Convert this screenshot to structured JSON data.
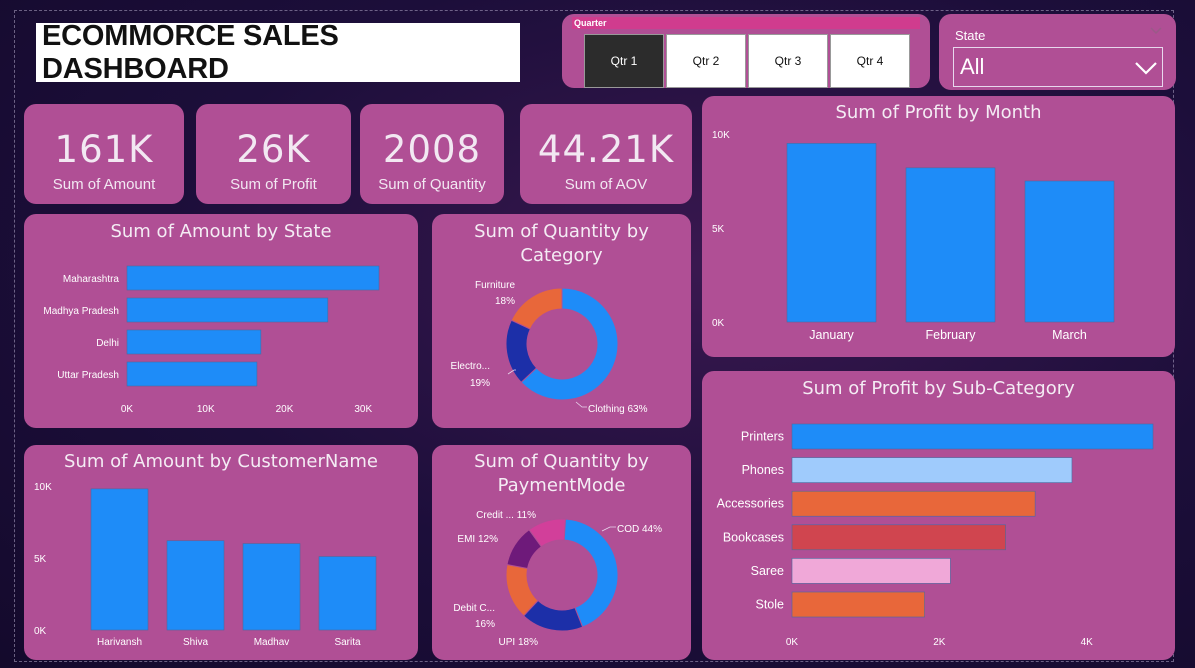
{
  "dashboard": {
    "title": "ECOMMORCE SALES DASHBOARD"
  },
  "quarter_slicer": {
    "title": "Quarter",
    "options": [
      "Qtr 1",
      "Qtr 2",
      "Qtr 3",
      "Qtr 4"
    ],
    "selected": "Qtr 1"
  },
  "state_slicer": {
    "label": "State",
    "value": "All"
  },
  "kpis": [
    {
      "value": "161K",
      "label": "Sum of Amount"
    },
    {
      "value": "26K",
      "label": "Sum of Profit"
    },
    {
      "value": "2008",
      "label": "Sum of Quantity"
    },
    {
      "value": "44.21K",
      "label": "Sum of AOV"
    }
  ],
  "colors": {
    "accent": "#1e8cf8",
    "card": "#b04f95",
    "donut_category": [
      "#1e8cf8",
      "#1c2fa8",
      "#e8673a"
    ],
    "donut_payment": [
      "#1e8cf8",
      "#1c2fa8",
      "#e8673a",
      "#6e1a7a",
      "#d23f9a"
    ],
    "subcategory": [
      "#1e8cf8",
      "#9fcbfc",
      "#e8673a",
      "#d0454f",
      "#f0a8d8",
      "#e8673a"
    ]
  },
  "chart_data": [
    {
      "type": "bar",
      "orientation": "horizontal",
      "title": "Sum of Amount by State",
      "categories": [
        "Maharashtra",
        "Madhya Pradesh",
        "Delhi",
        "Uttar Pradesh"
      ],
      "values": [
        32000,
        25500,
        17000,
        16500
      ],
      "xlim": [
        0,
        32000
      ],
      "x_ticks": [
        "0K",
        "10K",
        "20K",
        "30K"
      ],
      "x_tick_values": [
        0,
        10000,
        20000,
        30000
      ]
    },
    {
      "type": "pie",
      "variant": "donut",
      "title": "Sum of Quantity by Category",
      "slices": [
        {
          "label": "Clothing",
          "pct": 63
        },
        {
          "label": "Electro...",
          "pct": 19
        },
        {
          "label": "Furniture",
          "pct": 18
        }
      ],
      "slice_labels": [
        "Clothing 63%",
        "Electro...",
        "19%",
        "Furniture",
        "18%"
      ]
    },
    {
      "type": "bar",
      "title": "Sum of Profit by Month",
      "categories": [
        "January",
        "February",
        "March"
      ],
      "values": [
        9500,
        8200,
        7500
      ],
      "ylim": [
        0,
        10000
      ],
      "y_ticks": [
        "0K",
        "5K",
        "10K"
      ],
      "y_tick_values": [
        0,
        5000,
        10000
      ]
    },
    {
      "type": "bar",
      "title": "Sum of Amount by CustomerName",
      "categories": [
        "Harivansh",
        "Shiva",
        "Madhav",
        "Sarita"
      ],
      "values": [
        9800,
        6200,
        6000,
        5100
      ],
      "ylim": [
        0,
        10000
      ],
      "y_ticks": [
        "0K",
        "5K",
        "10K"
      ],
      "y_tick_values": [
        0,
        5000,
        10000
      ]
    },
    {
      "type": "pie",
      "variant": "donut",
      "title": "Sum of Quantity by PaymentMode",
      "slices": [
        {
          "label": "COD",
          "pct": 44
        },
        {
          "label": "UPI",
          "pct": 18
        },
        {
          "label": "Debit C...",
          "pct": 16
        },
        {
          "label": "EMI",
          "pct": 12
        },
        {
          "label": "Credit ...",
          "pct": 11
        }
      ],
      "slice_labels": [
        "COD 44%",
        "UPI 18%",
        "Debit C...",
        "16%",
        "EMI 12%",
        "Credit ... 11%"
      ]
    },
    {
      "type": "bar",
      "orientation": "horizontal",
      "title": "Sum of Profit by Sub-Category",
      "categories": [
        "Printers",
        "Phones",
        "Accessories",
        "Bookcases",
        "Saree",
        "Stole"
      ],
      "values": [
        4900,
        3800,
        3300,
        2900,
        2150,
        1800
      ],
      "xlim": [
        0,
        4900
      ],
      "x_ticks": [
        "0K",
        "2K",
        "4K"
      ],
      "x_tick_values": [
        0,
        2000,
        4000
      ]
    }
  ]
}
